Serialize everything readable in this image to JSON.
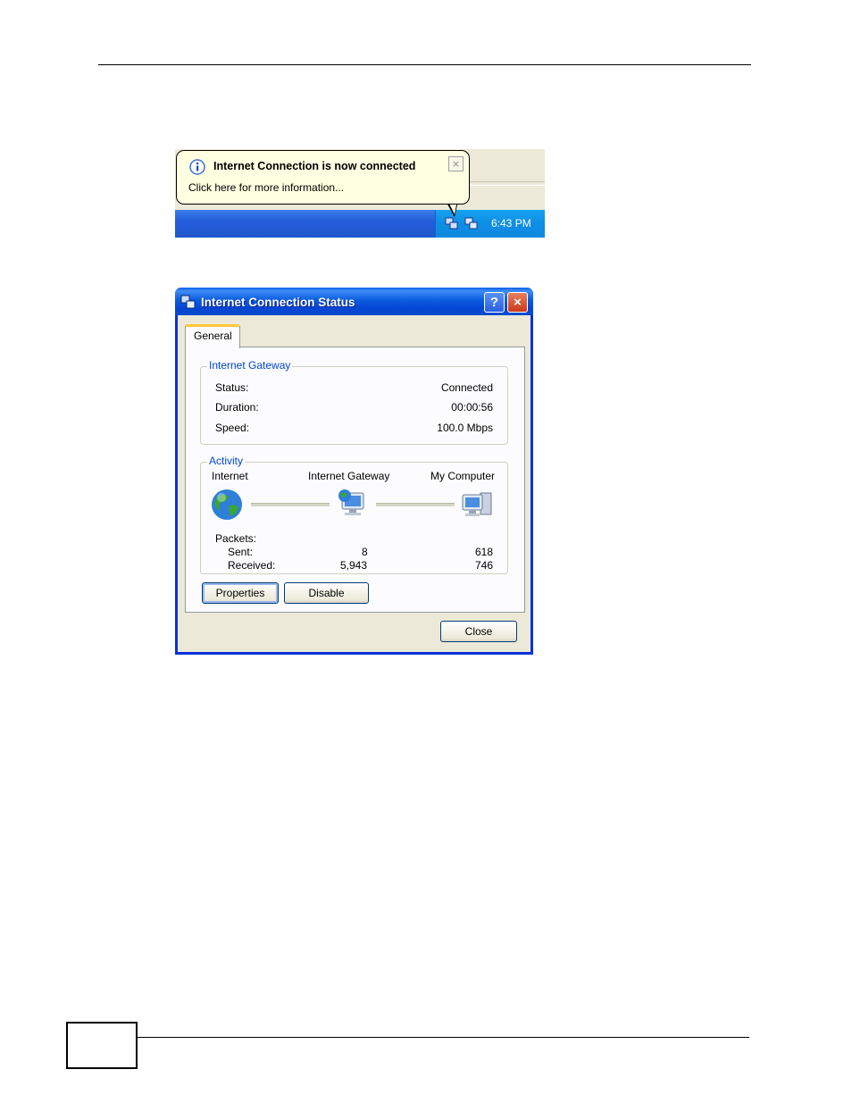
{
  "taskbar": {
    "balloon_title": "Internet Connection is now connected",
    "balloon_text": "Click here for more information...",
    "balloon_close": "×",
    "clock": "6:43 PM"
  },
  "dialog": {
    "title": "Internet Connection Status",
    "help_glyph": "?",
    "close_glyph": "×",
    "tab": "General",
    "gateway": {
      "label": "Internet Gateway",
      "status_label": "Status:",
      "status_value": "Connected",
      "duration_label": "Duration:",
      "duration_value": "00:00:56",
      "speed_label": "Speed:",
      "speed_value": "100.0 Mbps"
    },
    "activity": {
      "label": "Activity",
      "node_internet": "Internet",
      "node_gateway": "Internet Gateway",
      "node_computer": "My Computer",
      "packets_label": "Packets:",
      "sent_label": "Sent:",
      "received_label": "Received:",
      "gateway_sent": "8",
      "gateway_received": "5,943",
      "computer_sent": "618",
      "computer_received": "746"
    },
    "buttons": {
      "properties": "Properties",
      "disable": "Disable",
      "close": "Close"
    }
  },
  "colors": {
    "xp_blue": "#0831d9",
    "group_label": "#0046d5",
    "balloon_bg": "#ffffe1"
  }
}
